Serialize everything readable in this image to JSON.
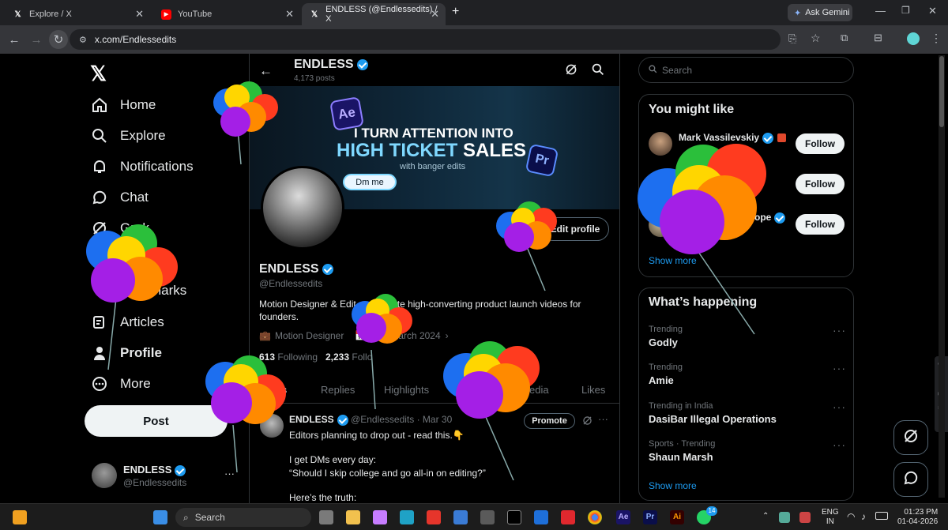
{
  "browser": {
    "tabs": [
      {
        "title": "Explore / X",
        "active": false
      },
      {
        "title": "YouTube",
        "active": false
      },
      {
        "title": "ENDLESS (@Endlessedits) / X",
        "active": true
      }
    ],
    "new_tab": "+",
    "ask_gemini": "Ask Gemini",
    "url": "x.com/Endlessedits"
  },
  "sidebar": {
    "items": [
      {
        "label": "Home",
        "icon": "home-icon"
      },
      {
        "label": "Explore",
        "icon": "search-icon"
      },
      {
        "label": "Notifications",
        "icon": "bell-icon"
      },
      {
        "label": "Chat",
        "icon": "chat-icon"
      },
      {
        "label": "Grok",
        "icon": "grok-icon"
      },
      {
        "label": "marks",
        "icon": "bookmark-icon"
      },
      {
        "label": "Articles",
        "icon": "articles-icon"
      },
      {
        "label": "Profile",
        "icon": "person-icon"
      },
      {
        "label": "More",
        "icon": "more-icon"
      }
    ],
    "post_label": "Post",
    "account": {
      "name": "ENDLESS",
      "handle": "@Endlessedits"
    }
  },
  "header": {
    "name": "ENDLESS",
    "posts": "4,173 posts"
  },
  "banner": {
    "line1": "I TURN ATTENTION INTO",
    "line2a": "HIGH TICKET",
    "line2b": "SALES",
    "line3": "with banger edits",
    "dm": "Dm me",
    "ae": "Ae",
    "pr": "Pr"
  },
  "profile": {
    "edit_label": "Edit profile",
    "name": "ENDLESS",
    "handle": "@Endlessedits",
    "bio_a": "Motion Designer & Edit",
    "bio_b": "te high-converting product launch videos for",
    "bio_c": "founders.",
    "job": "Motion Designer",
    "joined": "arch 2024",
    "following_count": "613",
    "following_label": "Following",
    "followers_count": "2,233",
    "followers_label": "Follo"
  },
  "profile_tabs": [
    "s",
    "Replies",
    "Highlights",
    "edia",
    "Likes"
  ],
  "post": {
    "name": "ENDLESS",
    "meta": "@Endlessedits · Mar 30",
    "promote": "Promote",
    "line1": "Editors planning to drop out - read this.👇",
    "line2": "I get DMs every day:",
    "line3": "“Should I skip college and go all-in on editing?”",
    "line4": "Here’s the truth:"
  },
  "search": {
    "placeholder": "Search"
  },
  "you_might_like": {
    "title": "You might like",
    "users": [
      {
        "name": "Mark Vassilevskiy",
        "follow": "Follow"
      },
      {
        "name": "",
        "follow": "Follow"
      },
      {
        "name": "ope",
        "follow": "Follow"
      }
    ],
    "show_more": "Show more"
  },
  "whats_happening": {
    "title": "What’s happening",
    "trends": [
      {
        "category": "Trending",
        "name": "Godly"
      },
      {
        "category": "Trending",
        "name": "Amie"
      },
      {
        "category": "Trending in India",
        "name": "DasiBar Illegal Operations"
      },
      {
        "category": "Sports · Trending",
        "name": "Shaun Marsh"
      }
    ],
    "show_more": "Show more"
  },
  "taskbar": {
    "search": "Search",
    "lang1": "ENG",
    "lang2": "IN",
    "time": "01:23 PM",
    "date": "01-04-2026",
    "badge": "14"
  },
  "colors": {
    "accent": "#1d9bf0",
    "bg": "#000000",
    "border": "#2f3336"
  }
}
